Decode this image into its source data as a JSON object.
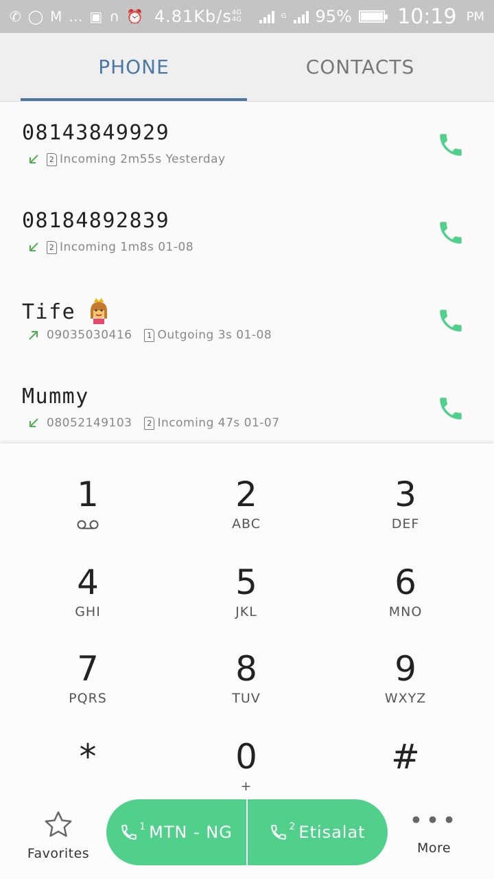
{
  "status_bar": {
    "speed": "4.81Kb/s",
    "network1": "4G 4G",
    "network2": "G",
    "battery": "95%",
    "battery_level": 0.95,
    "time": "10:19",
    "ampm": "PM"
  },
  "tabs": [
    {
      "label": "PHONE",
      "active": true
    },
    {
      "label": "CONTACTS",
      "active": false
    }
  ],
  "call_log": [
    {
      "name": "08143849929",
      "direction": "incoming",
      "number": "",
      "sim": "2",
      "detail": "Incoming 2m55s Yesterday",
      "emoji": false
    },
    {
      "name": "08184892839",
      "direction": "incoming",
      "number": "",
      "sim": "2",
      "detail": "Incoming 1m8s 01-08",
      "emoji": false
    },
    {
      "name": "Tife",
      "direction": "outgoing",
      "number": "09035030416",
      "sim": "1",
      "detail": "Outgoing 3s 01-08",
      "emoji": true
    },
    {
      "name": "Mummy",
      "direction": "incoming",
      "number": "08052149103",
      "sim": "2",
      "detail": "Incoming 47s 01-07",
      "emoji": false
    }
  ],
  "dialpad": [
    {
      "digit": "1",
      "letters": ""
    },
    {
      "digit": "2",
      "letters": "ABC"
    },
    {
      "digit": "3",
      "letters": "DEF"
    },
    {
      "digit": "4",
      "letters": "GHI"
    },
    {
      "digit": "5",
      "letters": "JKL"
    },
    {
      "digit": "6",
      "letters": "MNO"
    },
    {
      "digit": "7",
      "letters": "PQRS"
    },
    {
      "digit": "8",
      "letters": "TUV"
    },
    {
      "digit": "9",
      "letters": "WXYZ"
    },
    {
      "digit": "*",
      "letters": ""
    },
    {
      "digit": "0",
      "letters": "+"
    },
    {
      "digit": "#",
      "letters": ""
    }
  ],
  "bottom": {
    "favorites_label": "Favorites",
    "sim1_index": "1",
    "sim1_label": "MTN - NG",
    "sim2_index": "2",
    "sim2_label": "Etisalat",
    "more_label": "More"
  },
  "colors": {
    "accent": "#4a78a6",
    "call_green": "#50d08a",
    "incoming_arrow": "#4caf50",
    "outgoing_arrow": "#4caf50"
  }
}
